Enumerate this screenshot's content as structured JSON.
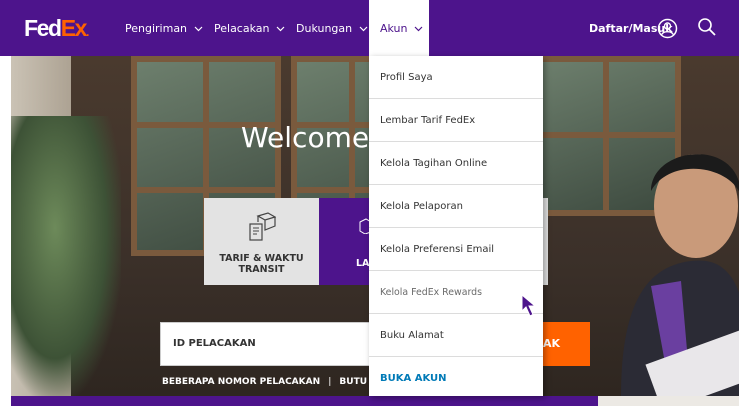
{
  "brand": {
    "logo_main": "Fed",
    "logo_accent": "Ex",
    "logo_dot": ".",
    "purple": "#4d148c",
    "orange": "#ff6200",
    "link_blue": "#007ab7"
  },
  "nav": {
    "items": [
      {
        "label": "Pengiriman"
      },
      {
        "label": "Pelacakan"
      },
      {
        "label": "Dukungan"
      },
      {
        "label": "Akun"
      }
    ],
    "login_label": "Daftar/Masuk",
    "user_icon": "user-circle-icon",
    "search_icon": "search-icon"
  },
  "hero": {
    "welcome": "Welcome",
    "tiles": [
      {
        "label_line1": "TARIF & WAKTU",
        "label_line2": "TRANSIT",
        "icon": "package-rate-icon"
      },
      {
        "label": "LA",
        "icon": "box-icon"
      }
    ],
    "tracking_label": "ID PELACAKAN",
    "tracking_button": "AK",
    "hint_left": "BEBERAPA NOMOR PELACAKAN",
    "hint_sep": "|",
    "hint_right": "BUTU"
  },
  "menu": {
    "items": [
      {
        "label": "Profil Saya"
      },
      {
        "label": "Lembar Tarif FedEx"
      },
      {
        "label": "Kelola Tagihan Online"
      },
      {
        "label": "Kelola Pelaporan"
      },
      {
        "label": "Kelola Preferensi Email"
      },
      {
        "label": "Kelola FedEx Rewards"
      },
      {
        "label": "Buku Alamat"
      },
      {
        "label": "BUKA AKUN"
      }
    ]
  }
}
